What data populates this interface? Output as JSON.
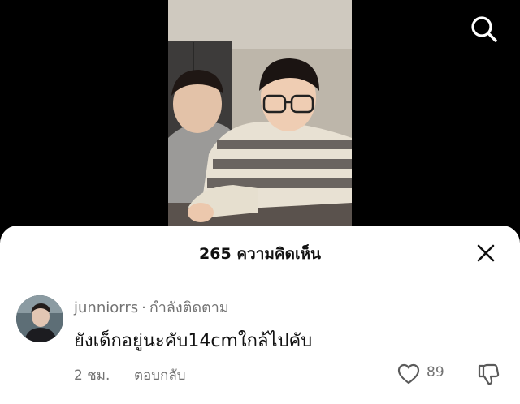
{
  "header": {
    "title": "265 ความคิดเห็น"
  },
  "icons": {
    "search": "search-icon",
    "close": "close-icon",
    "like": "heart-outline-icon",
    "dislike": "thumbs-down-icon"
  },
  "comment": {
    "username": "junniorrs",
    "separator": "·",
    "follow_status": "กำลังติดตาม",
    "text": "ยังเด็กอยู่นะคับ14cmใกล้ไปคับ",
    "time": "2 ชม.",
    "reply_label": "ตอบกลับ",
    "like_count": "89"
  },
  "colors": {
    "sheet_bg": "#ffffff",
    "secondary_text": "#737373",
    "primary_text": "#111111"
  }
}
